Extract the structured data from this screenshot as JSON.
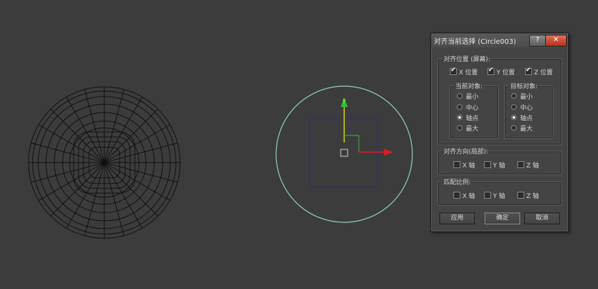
{
  "dialog": {
    "title": "对齐当前选择 (Circle003)",
    "help_label": "?",
    "close_label": "✕",
    "align_position": {
      "label": "对齐位置 (屏幕):",
      "x": {
        "label": "X 位置",
        "checked": true
      },
      "y": {
        "label": "Y 位置",
        "checked": true
      },
      "z": {
        "label": "Z 位置",
        "checked": true
      }
    },
    "current_object": {
      "label": "当前对象:",
      "options": [
        "最小",
        "中心",
        "轴点",
        "最大"
      ],
      "selected": "轴点"
    },
    "target_object": {
      "label": "目标对象:",
      "options": [
        "最小",
        "中心",
        "轴点",
        "最大"
      ],
      "selected": "轴点"
    },
    "align_orientation": {
      "label": "对齐方向(局部):",
      "x": {
        "label": "X 轴",
        "checked": false
      },
      "y": {
        "label": "Y 轴",
        "checked": false
      },
      "z": {
        "label": "Z 轴",
        "checked": false
      }
    },
    "match_scale": {
      "label": "匹配比例:",
      "x": {
        "label": "X 轴",
        "checked": false
      },
      "y": {
        "label": "Y 轴",
        "checked": false
      },
      "z": {
        "label": "Z 轴",
        "checked": false
      }
    },
    "buttons": {
      "apply": "应用",
      "ok": "确定",
      "cancel": "取消"
    }
  },
  "viewport": {
    "gizmo_axis_label": "y",
    "colors": {
      "background": "#3c3c3c",
      "circle": "#8fd6c0",
      "bbox": "#3a2a6a",
      "y_axis": "#2fbf2f",
      "x_axis": "#d42020",
      "wire": "#101010"
    }
  }
}
